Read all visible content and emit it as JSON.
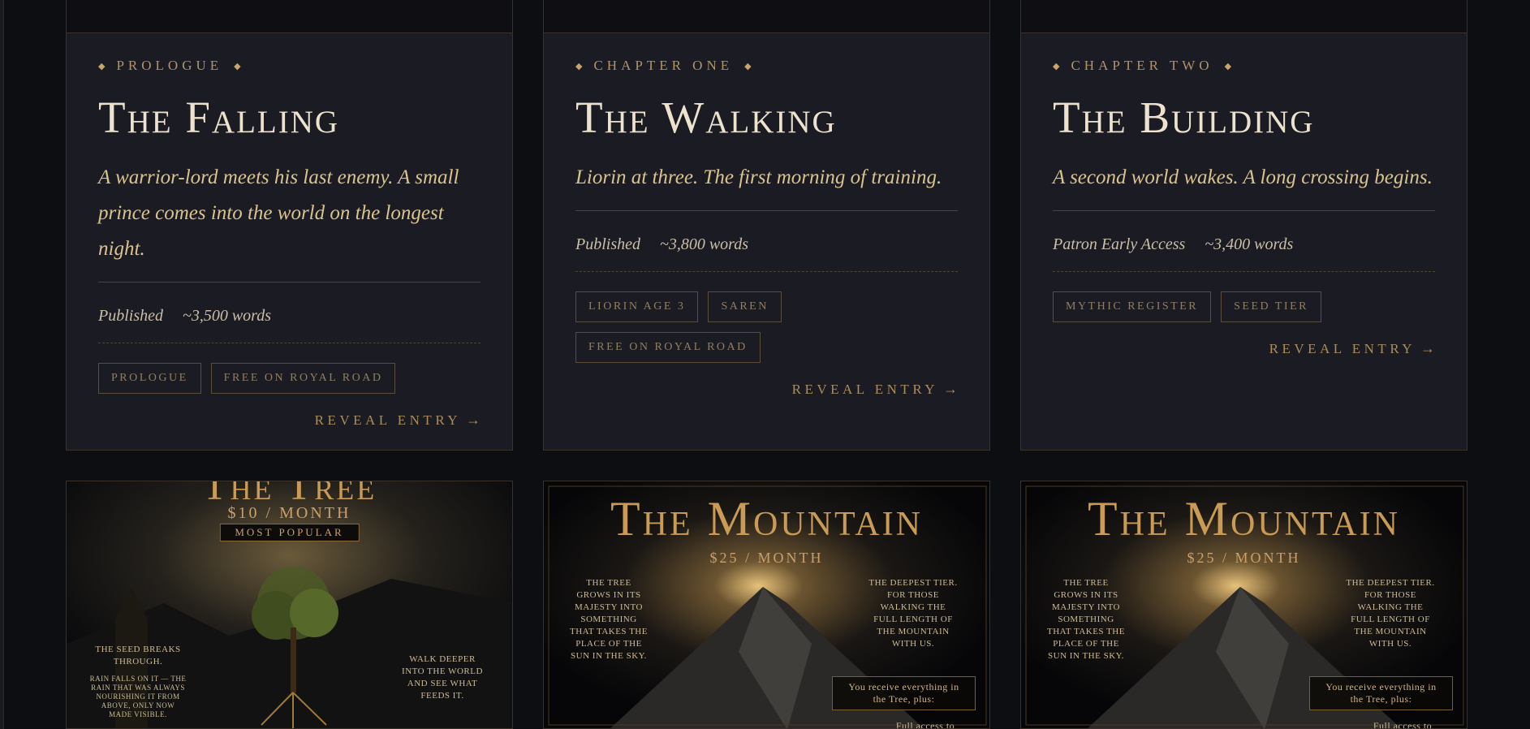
{
  "cards": [
    {
      "eyebrow": "PROLOGUE",
      "title": "The Falling",
      "description": "A warrior-lord meets his last enemy. A small prince comes into the world on the longest night.",
      "status": "Published",
      "words": "~3,500 words",
      "tags": [
        "PROLOGUE",
        "FREE ON ROYAL ROAD"
      ],
      "reveal": "REVEAL ENTRY"
    },
    {
      "eyebrow": "CHAPTER ONE",
      "title": "The Walking",
      "description": "Liorin at three. The first morning of training.",
      "status": "Published",
      "words": "~3,800 words",
      "tags": [
        "LIORIN AGE 3",
        "SAREN",
        "FREE ON ROYAL ROAD"
      ],
      "reveal": "REVEAL ENTRY"
    },
    {
      "eyebrow": "CHAPTER TWO",
      "title": "The Building",
      "description": "A second world wakes. A long crossing begins.",
      "status": "Patron Early Access",
      "words": "~3,400 words",
      "tags": [
        "MYTHIC REGISTER",
        "SEED TIER"
      ],
      "reveal": "REVEAL ENTRY"
    }
  ],
  "posters": [
    {
      "title": "The Tree",
      "price": "$10 / MONTH",
      "badge": "MOST POPULAR",
      "note_left_title": "The Seed Breaks Through.",
      "note_left_body": "Rain falls on it — the rain that was always nourishing it from above, only now made visible.",
      "note_right": "Walk deeper into the world and see what feeds it."
    },
    {
      "title": "The Mountain",
      "price": "$25 / MONTH",
      "note_left": "The Tree grows in its majesty into something that takes the place of the sun in the sky.",
      "note_right": "The Deepest tier. For those walking the full length of the mountain with us.",
      "box": "You receive everything in the Tree, plus:",
      "box_partial": "Full access to"
    },
    {
      "title": "The Mountain",
      "price": "$25 / MONTH",
      "note_left": "The Tree grows in its majesty into something that takes the place of the sun in the sky.",
      "note_right": "The Deepest tier. For those walking the full length of the mountain with us.",
      "box": "You receive everything in the Tree, plus:",
      "box_partial": "Full access to"
    }
  ],
  "colors": {
    "page_bg": "#0d0e11",
    "card_bg": "#1b1b23",
    "gold": "#c8a466",
    "title_cream": "#ece2cd"
  },
  "icons": {
    "eyebrow_marker": "diamond-icon",
    "reveal": "arrow-right-icon"
  }
}
